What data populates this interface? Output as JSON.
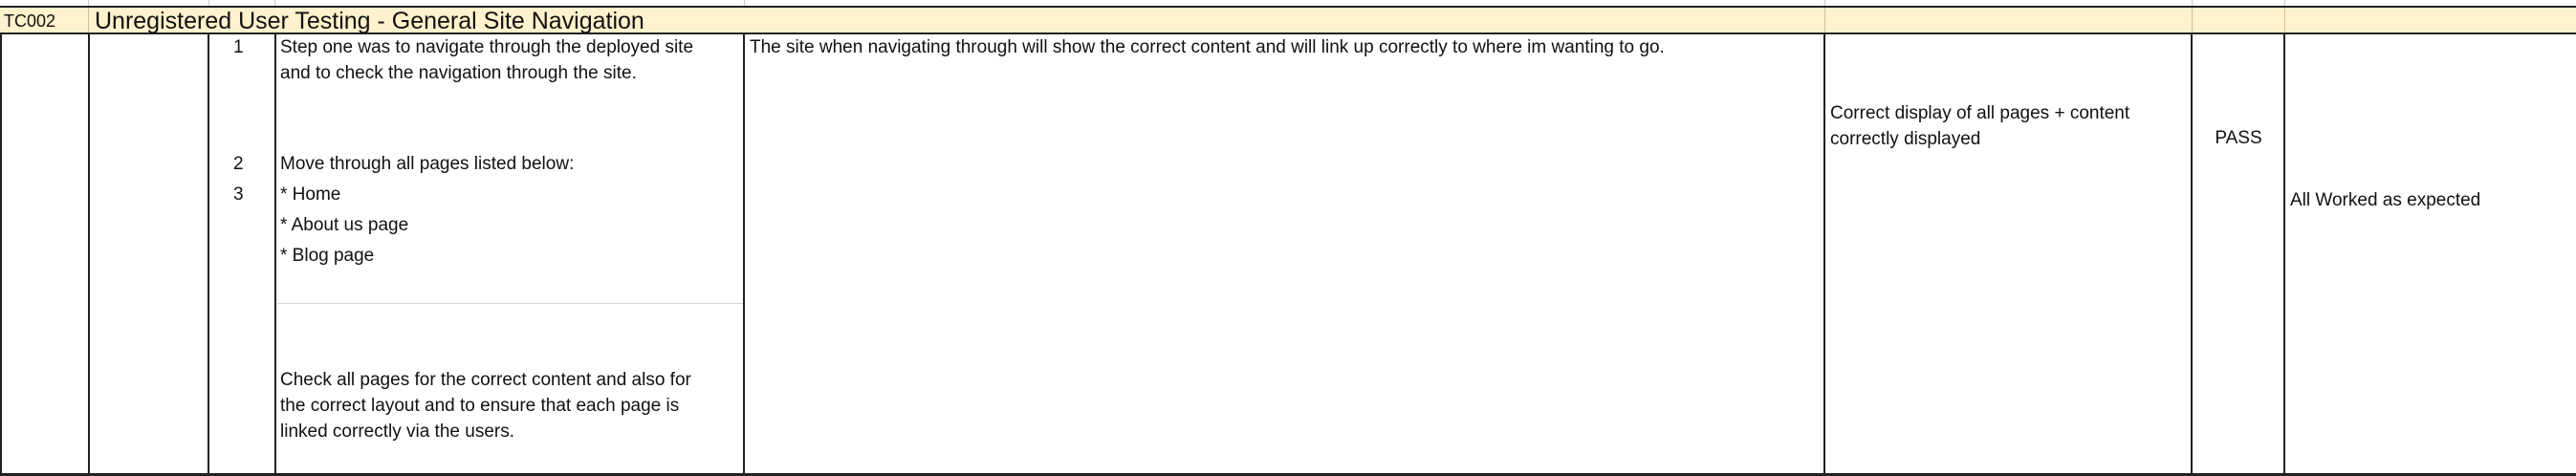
{
  "header": {
    "test_id": "TC002",
    "title": "Unregistered User Testing - General Site Navigation"
  },
  "steps": {
    "numbers": [
      "1",
      "2",
      "3"
    ],
    "step1": "Step one was to navigate through the deployed site\nand to check the navigation through the site.",
    "move_intro": "Move through all pages listed below:",
    "pages": [
      "* Home",
      "* About us page",
      "* Blog page"
    ],
    "check": "Check all pages for the correct content and also for\nthe correct layout and to ensure that each page is\nlinked correctly via the users."
  },
  "expected_result": "The site when navigating through will show the correct content and will link up correctly to where im wanting to go.",
  "actual_result": "Correct display of all pages + content\ncorrectly displayed",
  "status": "PASS",
  "comments": "All Worked as expected"
}
